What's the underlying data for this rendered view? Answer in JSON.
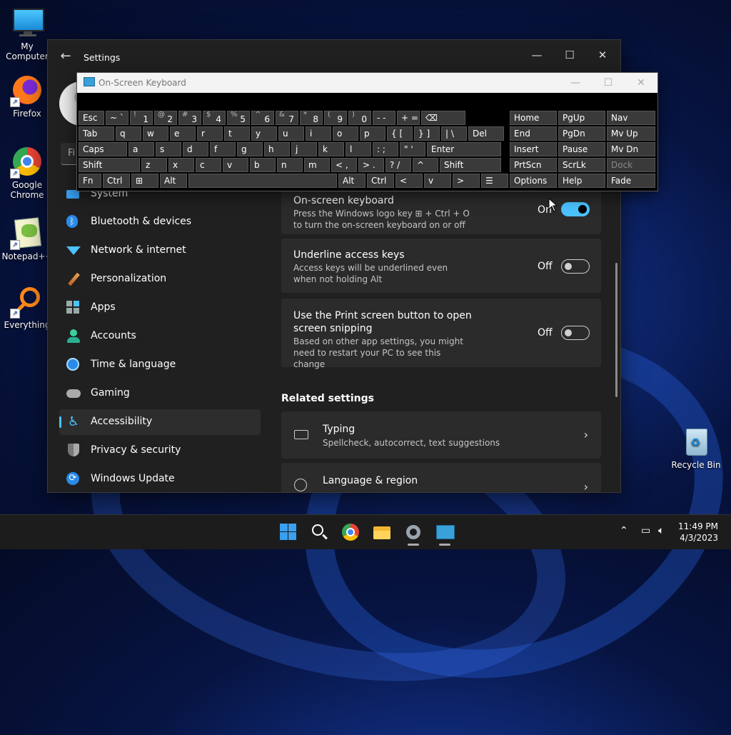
{
  "desktop": {
    "icons": [
      {
        "label": "My Computer"
      },
      {
        "label": "Firefox"
      },
      {
        "label": "Google Chrome"
      },
      {
        "label": "Notepad++"
      },
      {
        "label": "Everything"
      },
      {
        "label": "Recycle Bin"
      }
    ]
  },
  "settings": {
    "title": "Settings",
    "search_placeholder": "Fi",
    "nav": [
      {
        "label": "System",
        "icon": "system-icon"
      },
      {
        "label": "Bluetooth & devices",
        "icon": "bluetooth-icon"
      },
      {
        "label": "Network & internet",
        "icon": "wifi-icon"
      },
      {
        "label": "Personalization",
        "icon": "brush-icon"
      },
      {
        "label": "Apps",
        "icon": "apps-icon"
      },
      {
        "label": "Accounts",
        "icon": "person-icon"
      },
      {
        "label": "Time & language",
        "icon": "clock-globe-icon"
      },
      {
        "label": "Gaming",
        "icon": "gamepad-icon"
      },
      {
        "label": "Accessibility",
        "icon": "accessibility-icon",
        "active": true
      },
      {
        "label": "Privacy & security",
        "icon": "shield-icon"
      },
      {
        "label": "Windows Update",
        "icon": "update-icon"
      }
    ],
    "cards": [
      {
        "title": "On-screen keyboard",
        "desc": "Press the Windows logo key ⊞ + Ctrl + O to turn the on-screen keyboard on or off",
        "state": "On"
      },
      {
        "title": "Underline access keys",
        "desc": "Access keys will be underlined even when not holding Alt",
        "state": "Off"
      },
      {
        "title": "Use the Print screen button to open screen snipping",
        "desc": "Based on other app settings, you might need to restart your PC to see this change",
        "state": "Off"
      }
    ],
    "related_heading": "Related settings",
    "related": [
      {
        "title": "Typing",
        "desc": "Spellcheck, autocorrect, text suggestions"
      },
      {
        "title": "Language & region",
        "desc": ""
      }
    ]
  },
  "osk": {
    "title": "On-Screen Keyboard",
    "rows": [
      [
        [
          "Esc",
          ""
        ],
        [
          "~ `",
          ""
        ],
        [
          "! ",
          "1"
        ],
        [
          "@",
          "2"
        ],
        [
          "#",
          "3"
        ],
        [
          "$",
          "4"
        ],
        [
          "%",
          "5"
        ],
        [
          "^",
          "6"
        ],
        [
          "&",
          "7"
        ],
        [
          "*",
          "8"
        ],
        [
          "(",
          "9"
        ],
        [
          ")",
          "0"
        ],
        [
          "- -",
          ""
        ],
        [
          "+ =",
          ""
        ],
        [
          "⌫",
          ""
        ]
      ],
      [
        [
          "Tab",
          ""
        ],
        [
          "q",
          ""
        ],
        [
          "w",
          ""
        ],
        [
          "e",
          ""
        ],
        [
          "r",
          ""
        ],
        [
          "t",
          ""
        ],
        [
          "y",
          ""
        ],
        [
          "u",
          ""
        ],
        [
          "i",
          ""
        ],
        [
          "o",
          ""
        ],
        [
          "p",
          ""
        ],
        [
          "{  [",
          ""
        ],
        [
          "}  ]",
          ""
        ],
        [
          "|  \\",
          ""
        ],
        [
          "Del",
          ""
        ]
      ],
      [
        [
          "Caps",
          ""
        ],
        [
          "a",
          ""
        ],
        [
          "s",
          ""
        ],
        [
          "d",
          ""
        ],
        [
          "f",
          ""
        ],
        [
          "g",
          ""
        ],
        [
          "h",
          ""
        ],
        [
          "j",
          ""
        ],
        [
          "k",
          ""
        ],
        [
          "l",
          ""
        ],
        [
          ":  ;",
          ""
        ],
        [
          "\"  '",
          ""
        ],
        [
          "Enter",
          ""
        ]
      ],
      [
        [
          "Shift",
          ""
        ],
        [
          "z",
          ""
        ],
        [
          "x",
          ""
        ],
        [
          "c",
          ""
        ],
        [
          "v",
          ""
        ],
        [
          "b",
          ""
        ],
        [
          "n",
          ""
        ],
        [
          "m",
          ""
        ],
        [
          "<  ,",
          ""
        ],
        [
          ">  .",
          ""
        ],
        [
          "?  /",
          ""
        ],
        [
          "^",
          ""
        ],
        [
          "Shift",
          ""
        ]
      ],
      [
        [
          "Fn",
          ""
        ],
        [
          "Ctrl",
          ""
        ],
        [
          "⊞",
          ""
        ],
        [
          "Alt",
          ""
        ],
        [
          "",
          ""
        ],
        [
          "Alt",
          ""
        ],
        [
          "Ctrl",
          ""
        ],
        [
          "<",
          ""
        ],
        [
          "v",
          ""
        ],
        [
          ">",
          ""
        ],
        [
          "☰",
          ""
        ]
      ]
    ],
    "nav_keys": [
      [
        "Home",
        "PgUp",
        "Nav"
      ],
      [
        "End",
        "PgDn",
        "Mv Up"
      ],
      [
        "Insert",
        "Pause",
        "Mv Dn"
      ],
      [
        "PrtScn",
        "ScrLk",
        "Dock"
      ],
      [
        "Options",
        "Help",
        "Fade"
      ]
    ]
  },
  "taskbar": {
    "time": "11:49 PM",
    "date": "4/3/2023"
  }
}
